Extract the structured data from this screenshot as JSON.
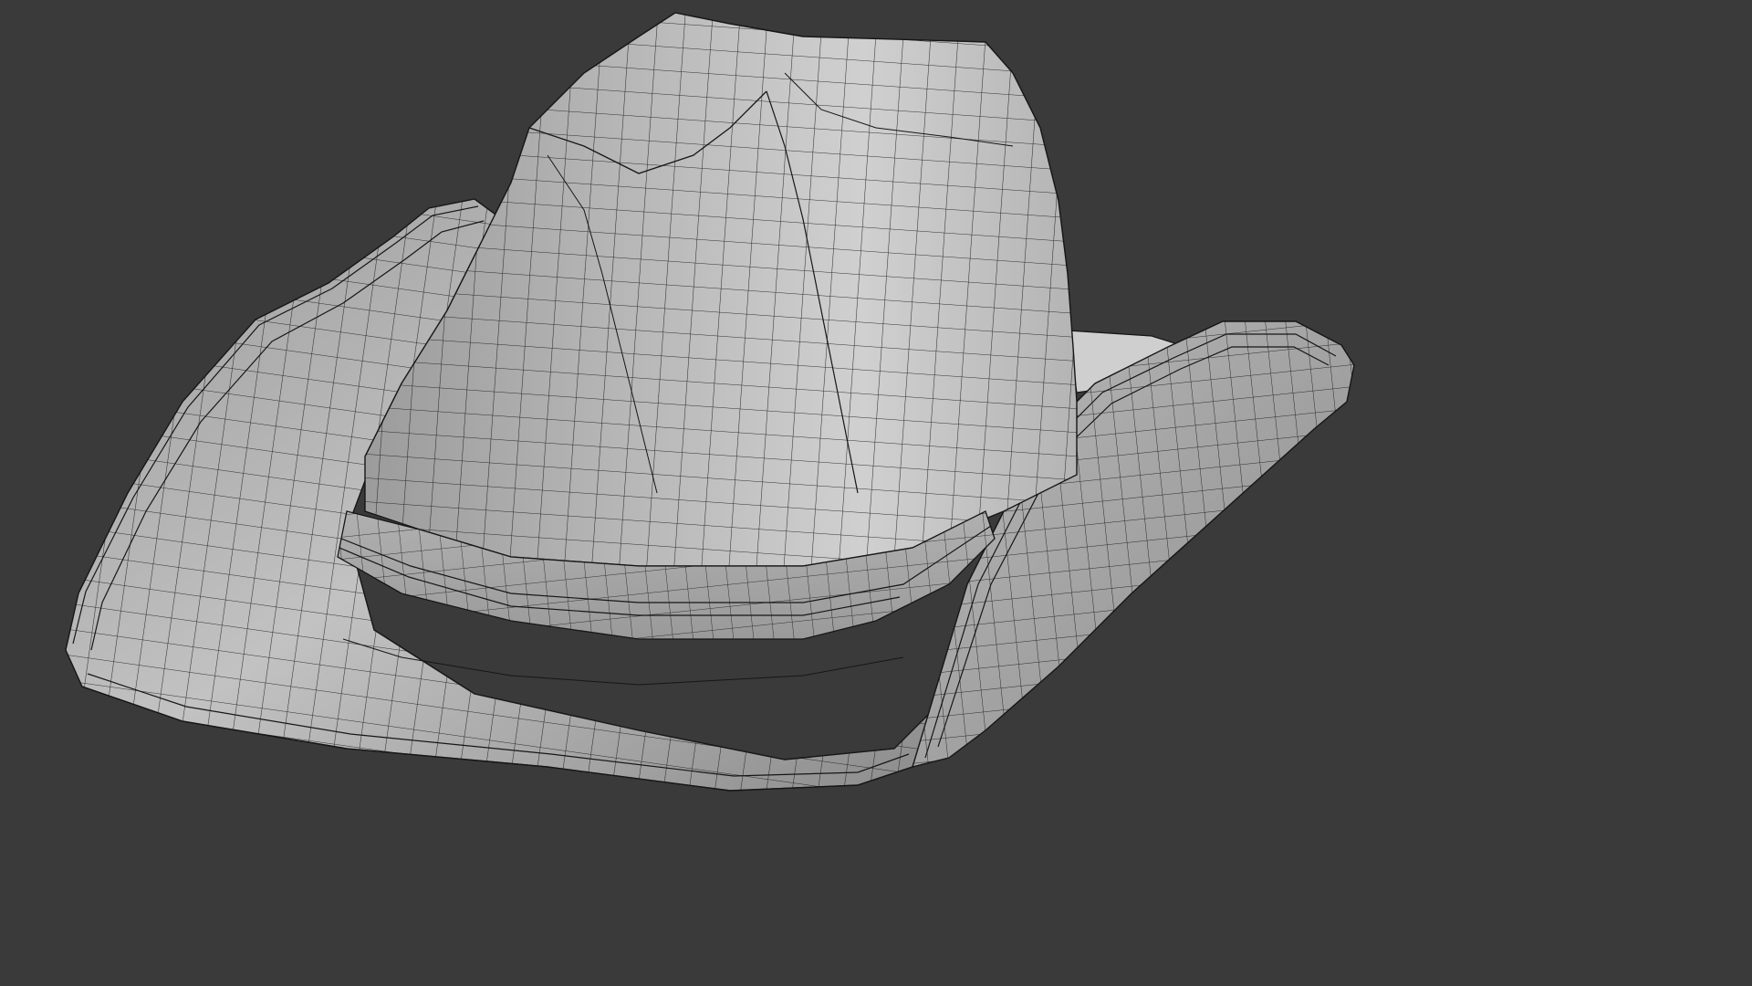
{
  "viewport": {
    "background_color": "#3a3a3a",
    "mode": "wireframe-on-shaded"
  },
  "model": {
    "object": "cowboy-hat",
    "shading_color": "#a8a8a8",
    "wire_color": "#141414",
    "parts": [
      "brim",
      "crown",
      "hat-band"
    ]
  }
}
